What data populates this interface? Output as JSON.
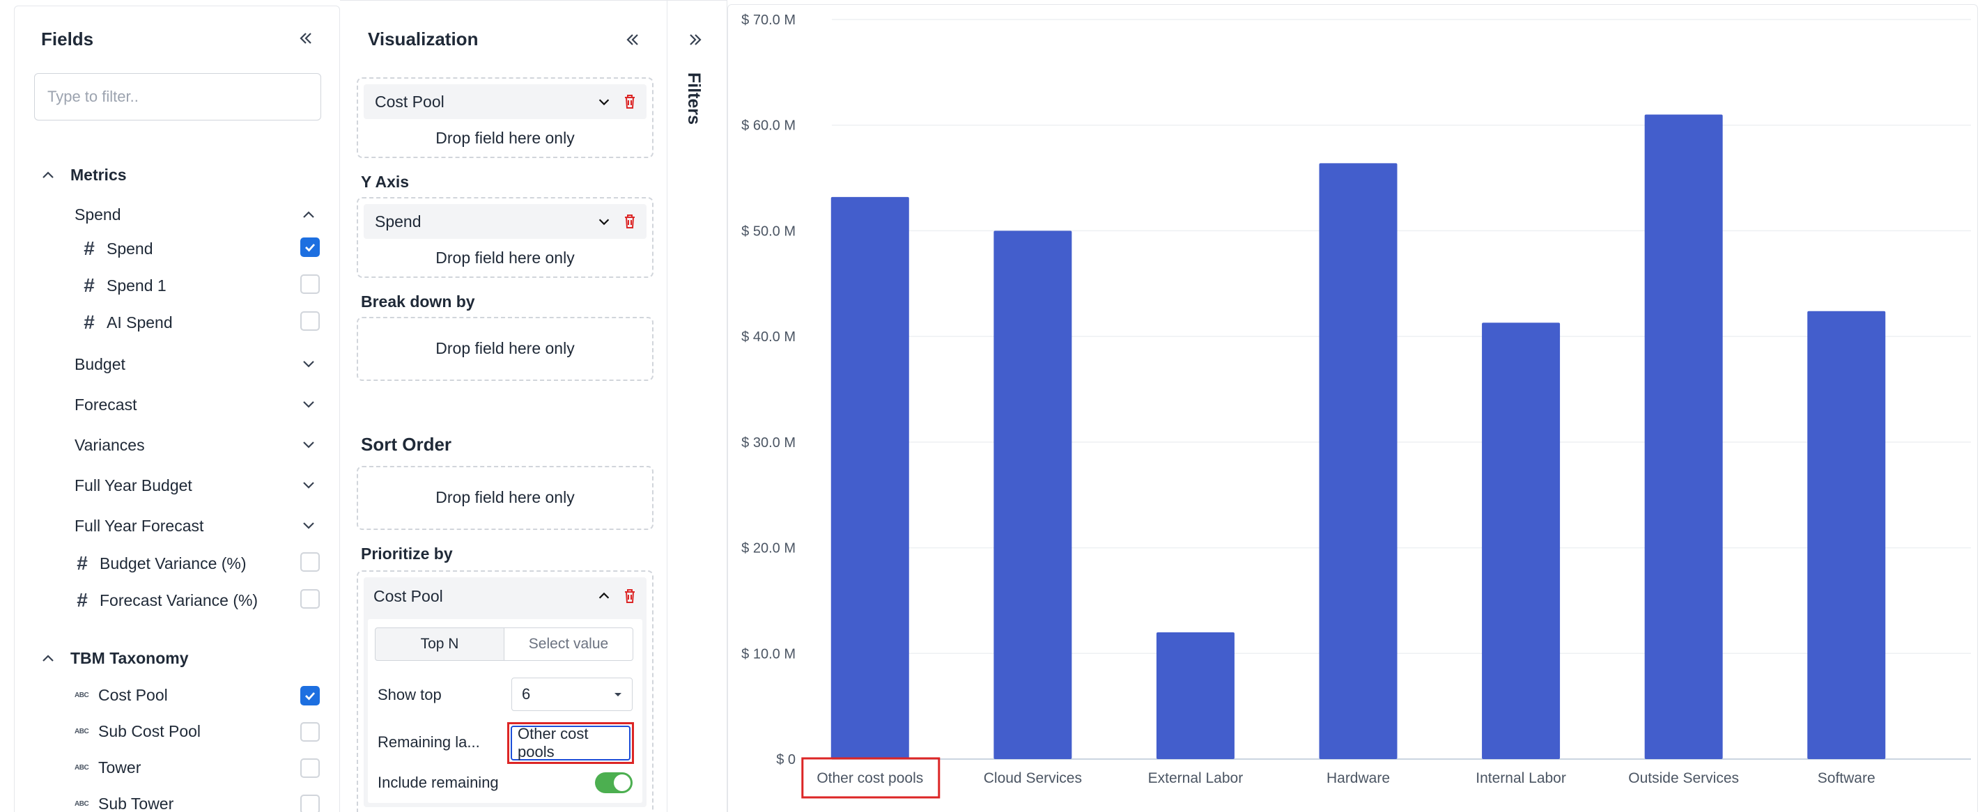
{
  "fields": {
    "title": "Fields",
    "filter_placeholder": "Type to filter..",
    "metrics_label": "Metrics",
    "spend_group": "Spend",
    "spend_items": [
      {
        "label": "Spend",
        "checked": true
      },
      {
        "label": "Spend 1",
        "checked": false
      },
      {
        "label": "AI Spend",
        "checked": false
      }
    ],
    "collapsed_groups": [
      "Budget",
      "Forecast",
      "Variances",
      "Full Year Budget",
      "Full Year Forecast"
    ],
    "metric_items": [
      {
        "label": "Budget Variance (%)",
        "checked": false
      },
      {
        "label": "Forecast Variance (%)",
        "checked": false
      }
    ],
    "taxonomy_label": "TBM Taxonomy",
    "taxonomy_items": [
      {
        "label": "Cost Pool",
        "checked": true
      },
      {
        "label": "Sub Cost Pool",
        "checked": false
      },
      {
        "label": "Tower",
        "checked": false
      },
      {
        "label": "Sub Tower",
        "checked": false
      }
    ],
    "abc_glyph": "ABC"
  },
  "viz": {
    "title": "Visualization",
    "x_axis_field": "Cost Pool",
    "drop_text": "Drop field here only",
    "y_axis_label": "Y Axis",
    "y_axis_field": "Spend",
    "breakdown_label": "Break down by",
    "sort_label": "Sort Order",
    "prioritize_label": "Prioritize by",
    "prioritize_field": "Cost Pool",
    "seg_top_n": "Top N",
    "seg_select_value": "Select value",
    "show_top_label": "Show top",
    "show_top_value": "6",
    "remaining_label": "Remaining la...",
    "remaining_value": "Other cost pools",
    "include_remaining_label": "Include remaining",
    "include_remaining_on": true
  },
  "filters": {
    "label": "Filters"
  },
  "colors": {
    "bar": "#435ecc",
    "checkbox": "#1d6fe0",
    "highlight": "#dc2626",
    "toggle": "#4caf50"
  },
  "chart_data": {
    "type": "bar",
    "categories": [
      "Other cost pools",
      "Cloud Services",
      "External Labor",
      "Hardware",
      "Internal Labor",
      "Outside Services",
      "Software"
    ],
    "values": [
      53.2,
      50.0,
      12.0,
      56.4,
      41.3,
      61.0,
      42.4
    ],
    "ylim": [
      0,
      70
    ],
    "yticks": [
      "$ 0",
      "$ 10.0 M",
      "$ 20.0 M",
      "$ 30.0 M",
      "$ 40.0 M",
      "$ 50.0 M",
      "$ 60.0 M",
      "$ 70.0 M"
    ],
    "grid": true,
    "highlighted_category": "Other cost pools"
  }
}
